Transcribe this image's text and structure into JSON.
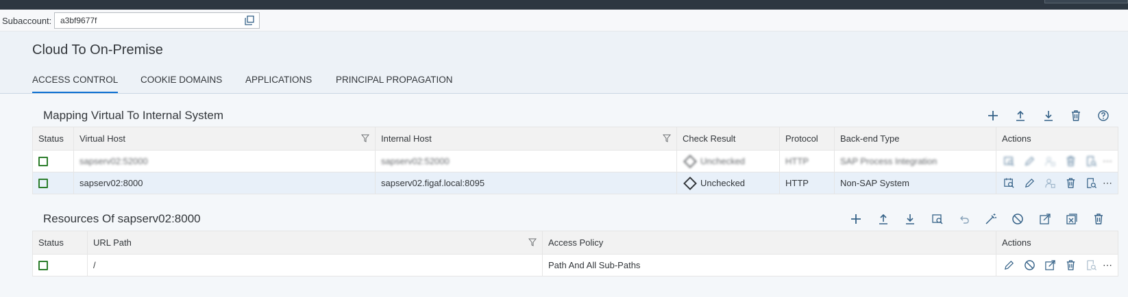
{
  "subaccount": {
    "label": "Subaccount:",
    "value": "a3bf9677f"
  },
  "page": {
    "title": "Cloud To On-Premise",
    "tabs": [
      {
        "label": "ACCESS CONTROL",
        "active": true
      },
      {
        "label": "COOKIE DOMAINS",
        "active": false
      },
      {
        "label": "APPLICATIONS",
        "active": false
      },
      {
        "label": "PRINCIPAL PROPAGATION",
        "active": false
      }
    ]
  },
  "mapping": {
    "title": "Mapping Virtual To Internal System",
    "columns": [
      "Status",
      "Virtual Host",
      "Internal Host",
      "Check Result",
      "Protocol",
      "Back-end Type",
      "Actions"
    ],
    "rows": [
      {
        "virtual_host": "sapserv02:52000",
        "internal_host": "sapserv02:52000",
        "check_result": "Unchecked",
        "protocol": "HTTP",
        "backend_type": "SAP Process Integration"
      },
      {
        "virtual_host": "sapserv02:8000",
        "internal_host": "sapserv02.figaf.local:8095",
        "check_result": "Unchecked",
        "protocol": "HTTP",
        "backend_type": "Non-SAP System"
      }
    ]
  },
  "resources": {
    "title": "Resources Of sapserv02:8000",
    "columns": [
      "Status",
      "URL Path",
      "Access Policy",
      "Actions"
    ],
    "rows": [
      {
        "url_path": "/",
        "access_policy": "Path And All Sub-Paths"
      }
    ]
  },
  "icons": {
    "status_color": "#2b7d2b",
    "accent": "#0a6ed1",
    "icon_color": "#346187"
  }
}
